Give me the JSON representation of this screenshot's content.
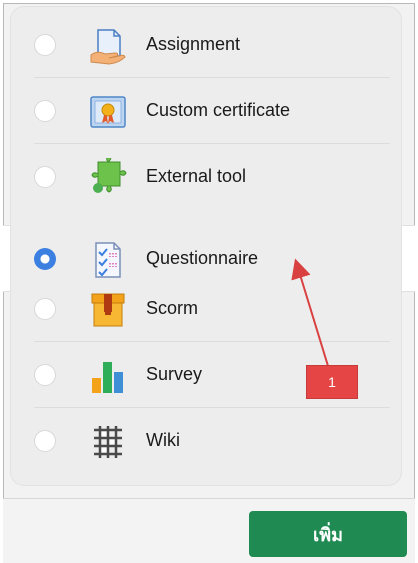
{
  "activities": [
    {
      "label": "Assignment",
      "icon": "assignment-icon",
      "selected": false
    },
    {
      "label": "Custom certificate",
      "icon": "certificate-icon",
      "selected": false
    },
    {
      "label": "External tool",
      "icon": "puzzle-icon",
      "selected": false
    },
    {
      "label": "Questionnaire",
      "icon": "questionnaire-icon",
      "selected": true
    },
    {
      "label": "Scorm",
      "icon": "package-icon",
      "selected": false
    },
    {
      "label": "Survey",
      "icon": "bar-chart-icon",
      "selected": false
    },
    {
      "label": "Wiki",
      "icon": "wiki-icon",
      "selected": false
    }
  ],
  "footer": {
    "add_label": "เพิ่ม"
  },
  "annotation": {
    "number": "1"
  },
  "colors": {
    "accent": "#3b7fe0",
    "button": "#1f8a52",
    "annotation": "#e54545"
  }
}
